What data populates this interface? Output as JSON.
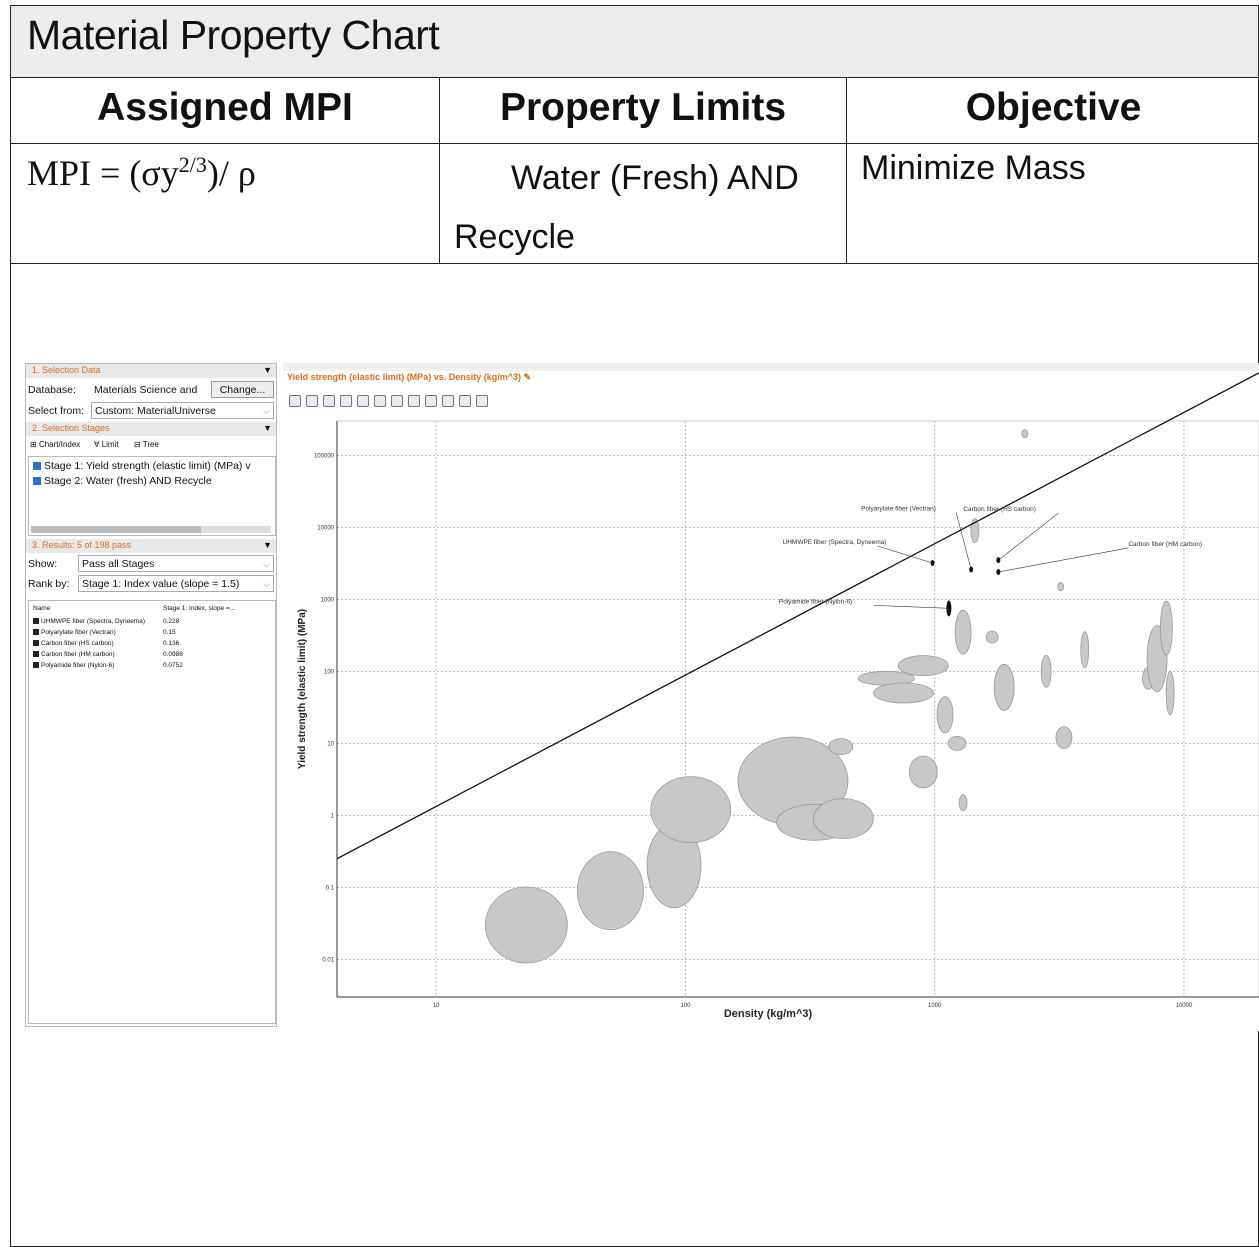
{
  "document": {
    "title": "Material Property Chart",
    "headers": [
      "Assigned MPI",
      "Property Limits",
      "Objective"
    ],
    "mpi": {
      "prefix": "MPI = (σy",
      "exponent": "2/3",
      "suffix": ")/ ρ"
    },
    "property_limits": "Water (Fresh) AND Recycle",
    "objective": "Minimize Mass"
  },
  "left_panel": {
    "selection_data_title": "1. Selection Data",
    "database_label": "Database:",
    "database_value": "Materials Science and",
    "change_button": "Change...",
    "select_from_label": "Select from:",
    "select_from_value": "Custom: MaterialUniverse",
    "selection_stages_title": "2. Selection Stages",
    "stage_tools": [
      "Chart/Index",
      "Limit",
      "Tree"
    ],
    "stages": [
      "Stage 1: Yield strength (elastic limit) (MPa) v",
      "Stage 2: Water (fresh) AND Recycle"
    ],
    "results_title": "3. Results: 5 of 198 pass",
    "show_label": "Show:",
    "show_value": "Pass all Stages",
    "rank_label": "Rank by:",
    "rank_value": "Stage 1: Index value (slope = 1.5)",
    "results_header_name": "Name",
    "results_header_value": "Stage 1: Index, slope =...",
    "results": [
      {
        "name": "UHMWPE fiber (Spectra, Dyneema)",
        "value": "0.228"
      },
      {
        "name": "Polyarylate fiber (Vectran)",
        "value": "0.15"
      },
      {
        "name": "Carbon fiber (HS carbon)",
        "value": "0.136"
      },
      {
        "name": "Carbon fiber (HM carbon)",
        "value": "0.0986"
      },
      {
        "name": "Polyamide fiber (Nylon-6)",
        "value": "0.0752"
      }
    ]
  },
  "chart_panel": {
    "title": "Yield strength (elastic limit) (MPa) vs. Density (kg/m^3)",
    "toolbar_icons": [
      "select-icon",
      "pointer-icon",
      "line-icon",
      "box-icon",
      "stage-icon",
      "zoom-in-icon",
      "zoom-out-icon",
      "fit-icon",
      "label-icon",
      "pen-icon",
      "axis-icon",
      "chart-type-icon"
    ]
  },
  "chart_data": {
    "type": "scatter",
    "xlabel": "Density (kg/m^3)",
    "ylabel": "Yield strength (elastic limit) (MPa)",
    "x_scale": "log",
    "y_scale": "log",
    "xlim": [
      4,
      20000
    ],
    "ylim": [
      0.003,
      300000
    ],
    "x_ticks": [
      "10",
      "100",
      "1000",
      "10000"
    ],
    "y_ticks": [
      "0.01",
      "0.1",
      "1",
      "10",
      "100",
      "1000",
      "10000",
      "100000"
    ],
    "grid": true,
    "guideline": {
      "slope": 1.5,
      "points": [
        [
          4,
          0.25
        ],
        [
          20000,
          1400000
        ]
      ]
    },
    "labeled_points": [
      {
        "name": "UHMWPE fiber (Spectra, Dyneema)",
        "x": 980,
        "y": 3200
      },
      {
        "name": "Polyarylate fiber (Vectran)",
        "x": 1400,
        "y": 2600
      },
      {
        "name": "Carbon fiber (HS carbon)",
        "x": 1800,
        "y": 3500
      },
      {
        "name": "Carbon fiber (HM carbon)",
        "x": 1800,
        "y": 2400
      },
      {
        "name": "Polyamide fiber (Nylon-6)",
        "x": 1140,
        "y": 750
      }
    ],
    "bubbles": [
      {
        "x": 23,
        "y": 0.03,
        "rx": 41,
        "ry": 38
      },
      {
        "x": 50,
        "y": 0.09,
        "rx": 33,
        "ry": 39
      },
      {
        "x": 90,
        "y": 0.2,
        "rx": 27,
        "ry": 42
      },
      {
        "x": 105,
        "y": 1.2,
        "rx": 40,
        "ry": 33
      },
      {
        "x": 270,
        "y": 3,
        "rx": 55,
        "ry": 44
      },
      {
        "x": 330,
        "y": 0.8,
        "rx": 38,
        "ry": 18
      },
      {
        "x": 430,
        "y": 0.9,
        "rx": 30,
        "ry": 20
      },
      {
        "x": 420,
        "y": 9,
        "rx": 12,
        "ry": 8
      },
      {
        "x": 640,
        "y": 80,
        "rx": 28,
        "ry": 7
      },
      {
        "x": 750,
        "y": 50,
        "rx": 30,
        "ry": 10
      },
      {
        "x": 900,
        "y": 120,
        "rx": 25,
        "ry": 10
      },
      {
        "x": 900,
        "y": 4,
        "rx": 14,
        "ry": 16
      },
      {
        "x": 1100,
        "y": 25,
        "rx": 8,
        "ry": 18
      },
      {
        "x": 1230,
        "y": 10,
        "rx": 9,
        "ry": 7
      },
      {
        "x": 1300,
        "y": 350,
        "rx": 8,
        "ry": 22
      },
      {
        "x": 1300,
        "y": 1.5,
        "rx": 4,
        "ry": 8
      },
      {
        "x": 1450,
        "y": 9000,
        "rx": 4,
        "ry": 12
      },
      {
        "x": 1700,
        "y": 300,
        "rx": 6,
        "ry": 6
      },
      {
        "x": 1900,
        "y": 60,
        "rx": 10,
        "ry": 23
      },
      {
        "x": 2300,
        "y": 200000,
        "rx": 3,
        "ry": 4
      },
      {
        "x": 2800,
        "y": 100,
        "rx": 5,
        "ry": 16
      },
      {
        "x": 3200,
        "y": 1500,
        "rx": 3,
        "ry": 4
      },
      {
        "x": 3300,
        "y": 12,
        "rx": 8,
        "ry": 11
      },
      {
        "x": 4000,
        "y": 200,
        "rx": 4,
        "ry": 18
      },
      {
        "x": 7200,
        "y": 80,
        "rx": 6,
        "ry": 11
      },
      {
        "x": 7800,
        "y": 150,
        "rx": 10,
        "ry": 33
      },
      {
        "x": 8500,
        "y": 400,
        "rx": 6,
        "ry": 27
      },
      {
        "x": 8800,
        "y": 50,
        "rx": 4,
        "ry": 22
      }
    ]
  }
}
